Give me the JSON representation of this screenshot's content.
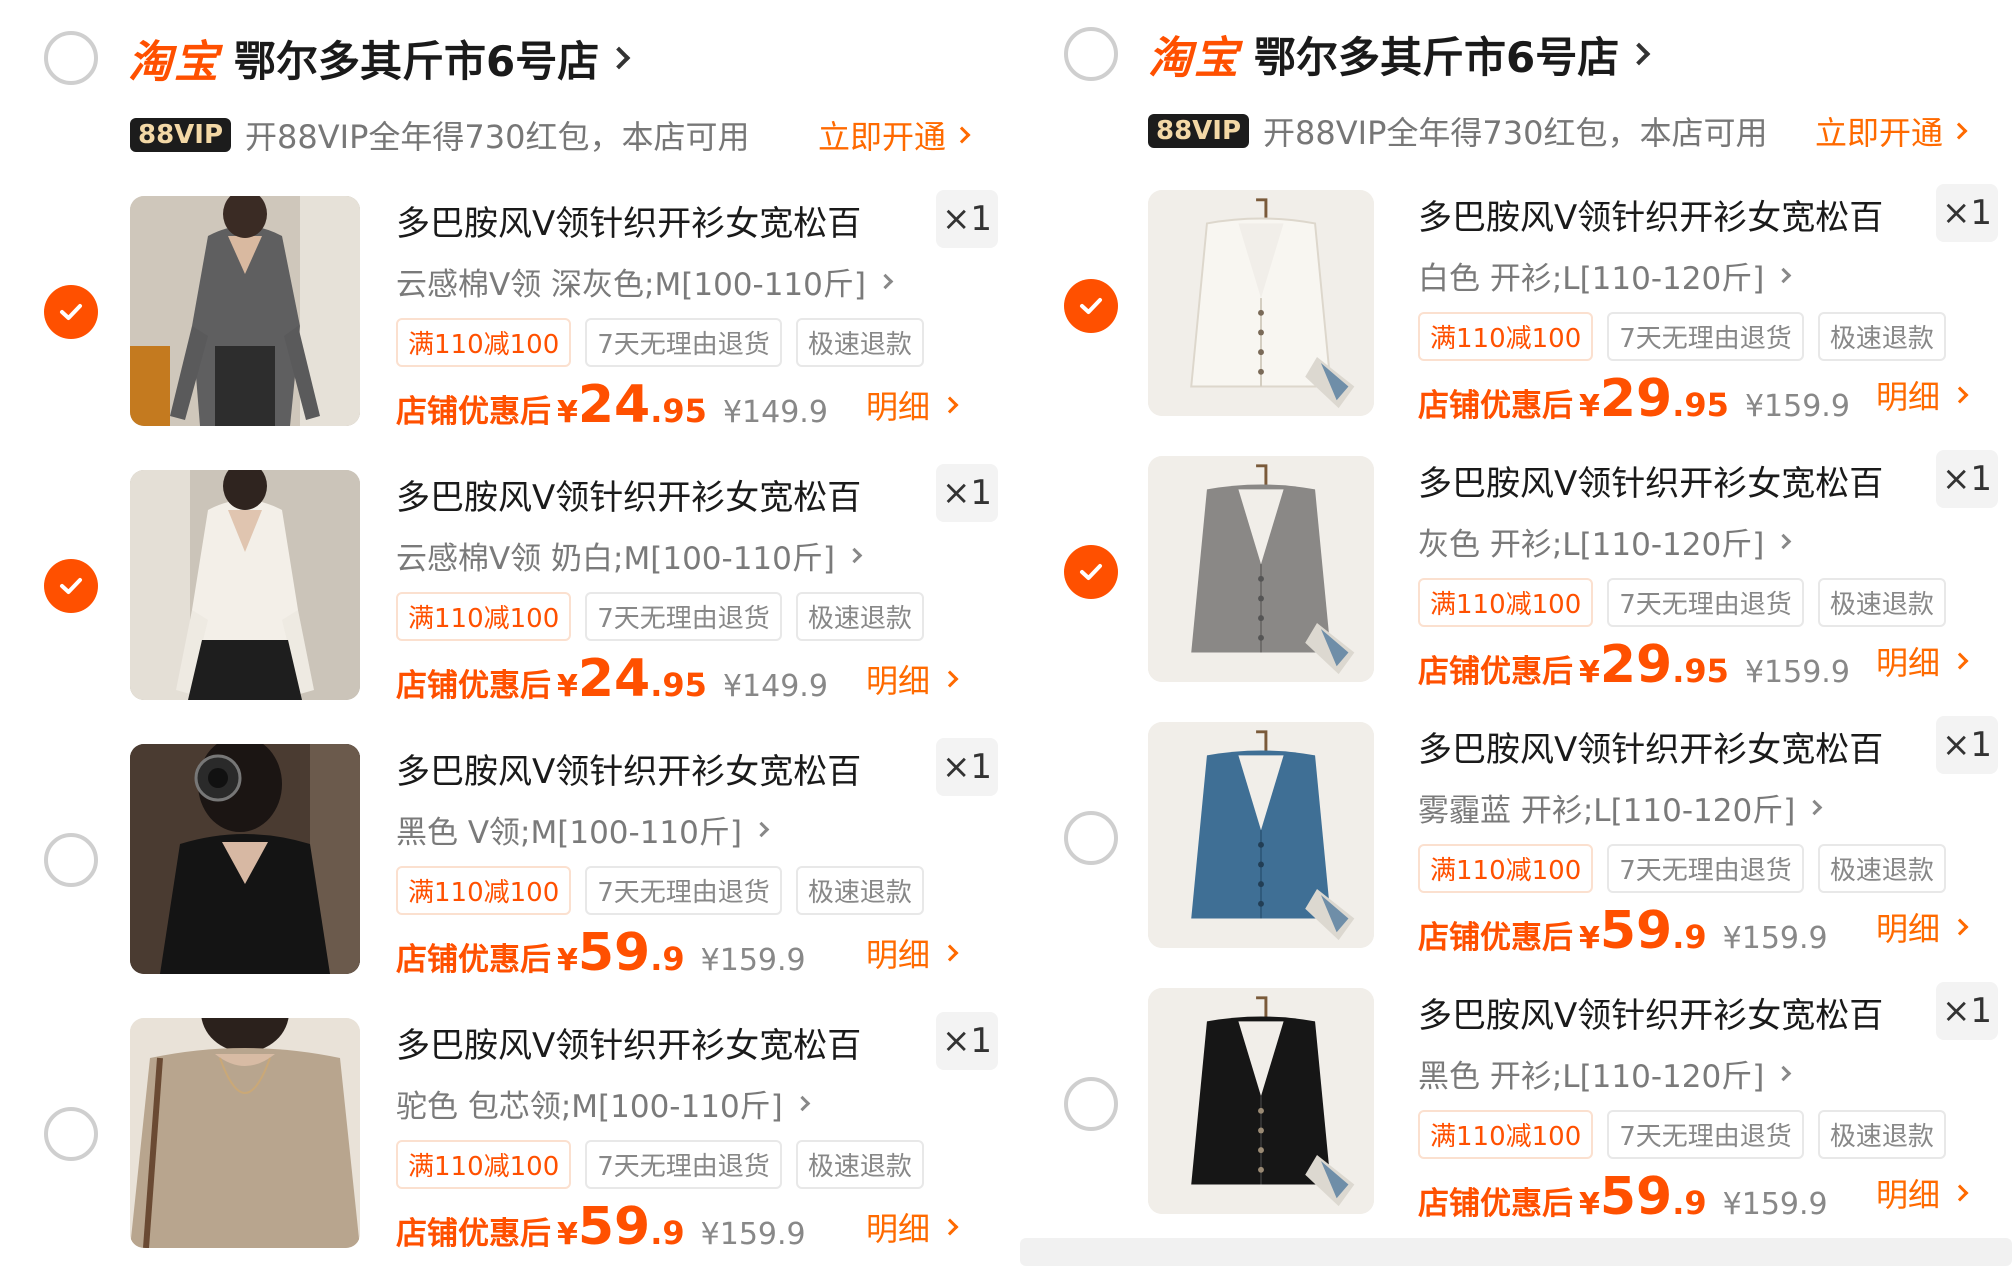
{
  "left": {
    "shop": {
      "platform": "淘宝",
      "name": "鄂尔多其斤市6号店"
    },
    "vip": {
      "badge": "88VIP",
      "text": "开88VIP全年得730红包，本店可用",
      "cta": "立即开通"
    },
    "items": [
      {
        "checked": true,
        "title": "多巴胺风V领针织开衫女宽松百",
        "qty": "×1",
        "spec": "云感棉V领 深灰色;M[100-110斤]",
        "tags": [
          "满110减100",
          "7天无理由退货",
          "极速退款"
        ],
        "price_label": "店铺优惠后",
        "yen": "¥",
        "price_int": "24",
        "price_dec": ".95",
        "orig_price": "¥149.9",
        "detail": "明细"
      },
      {
        "checked": true,
        "title": "多巴胺风V领针织开衫女宽松百",
        "qty": "×1",
        "spec": "云感棉V领 奶白;M[100-110斤]",
        "tags": [
          "满110减100",
          "7天无理由退货",
          "极速退款"
        ],
        "price_label": "店铺优惠后",
        "yen": "¥",
        "price_int": "24",
        "price_dec": ".95",
        "orig_price": "¥149.9",
        "detail": "明细"
      },
      {
        "checked": false,
        "title": "多巴胺风V领针织开衫女宽松百",
        "qty": "×1",
        "spec": "黑色 V领;M[100-110斤]",
        "tags": [
          "满110减100",
          "7天无理由退货",
          "极速退款"
        ],
        "price_label": "店铺优惠后",
        "yen": "¥",
        "price_int": "59",
        "price_dec": ".9",
        "orig_price": "¥159.9",
        "detail": "明细"
      },
      {
        "checked": false,
        "title": "多巴胺风V领针织开衫女宽松百",
        "qty": "×1",
        "spec": "驼色 包芯领;M[100-110斤]",
        "tags": [
          "满110减100",
          "7天无理由退货",
          "极速退款"
        ],
        "price_label": "店铺优惠后",
        "yen": "¥",
        "price_int": "59",
        "price_dec": ".9",
        "orig_price": "¥159.9",
        "detail": "明细"
      }
    ]
  },
  "right": {
    "shop": {
      "platform": "淘宝",
      "name": "鄂尔多其斤市6号店"
    },
    "vip": {
      "badge": "88VIP",
      "text": "开88VIP全年得730红包，本店可用",
      "cta": "立即开通"
    },
    "items": [
      {
        "checked": true,
        "title": "多巴胺风V领针织开衫女宽松百",
        "qty": "×1",
        "spec": "白色 开衫;L[110-120斤]",
        "tags": [
          "满110减100",
          "7天无理由退货",
          "极速退款"
        ],
        "price_label": "店铺优惠后",
        "yen": "¥",
        "price_int": "29",
        "price_dec": ".95",
        "orig_price": "¥159.9",
        "detail": "明细"
      },
      {
        "checked": true,
        "title": "多巴胺风V领针织开衫女宽松百",
        "qty": "×1",
        "spec": "灰色 开衫;L[110-120斤]",
        "tags": [
          "满110减100",
          "7天无理由退货",
          "极速退款"
        ],
        "price_label": "店铺优惠后",
        "yen": "¥",
        "price_int": "29",
        "price_dec": ".95",
        "orig_price": "¥159.9",
        "detail": "明细"
      },
      {
        "checked": false,
        "title": "多巴胺风V领针织开衫女宽松百",
        "qty": "×1",
        "spec": "雾霾蓝 开衫;L[110-120斤]",
        "tags": [
          "满110减100",
          "7天无理由退货",
          "极速退款"
        ],
        "price_label": "店铺优惠后",
        "yen": "¥",
        "price_int": "59",
        "price_dec": ".9",
        "orig_price": "¥159.9",
        "detail": "明细"
      },
      {
        "checked": false,
        "title": "多巴胺风V领针织开衫女宽松百",
        "qty": "×1",
        "spec": "黑色 开衫;L[110-120斤]",
        "tags": [
          "满110减100",
          "7天无理由退货",
          "极速退款"
        ],
        "price_label": "店铺优惠后",
        "yen": "¥",
        "price_int": "59",
        "price_dec": ".9",
        "orig_price": "¥159.9",
        "detail": "明细"
      }
    ]
  },
  "colors": {
    "accent": "#ff5000",
    "text": "#1a1a1a",
    "muted": "#7a7a7a",
    "vip_bg": "#1c1c1c",
    "vip_fg": "#f3d8a6"
  }
}
